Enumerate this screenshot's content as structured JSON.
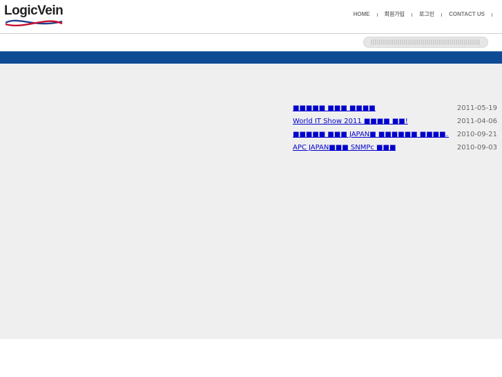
{
  "brand": {
    "name": "LogicVein",
    "swoosh_colors": [
      "#1f3f8f",
      "#c8102e"
    ]
  },
  "nav": {
    "items": [
      {
        "label": "HOME"
      },
      {
        "label": "회원가입"
      },
      {
        "label": "로그인"
      },
      {
        "label": "CONTACT US"
      }
    ]
  },
  "news": {
    "items": [
      {
        "title": "■■■■■ ■■■ ■■■■",
        "date": "2011-05-19"
      },
      {
        "title": "World IT Show 2011 ■■■■ ■■!",
        "date": "2011-04-06"
      },
      {
        "title": "■■■■■ ■■■ JAPAN■ ■■■■■■ ■■■■...",
        "date": "2010-09-21"
      },
      {
        "title": "APC JAPAN■■■ SNMPc ■■■",
        "date": "2010-09-03"
      }
    ]
  },
  "colors": {
    "header_bar": "#0f4b95",
    "content_bg": "#efefef",
    "link": "#0000cc",
    "date": "#666666"
  }
}
